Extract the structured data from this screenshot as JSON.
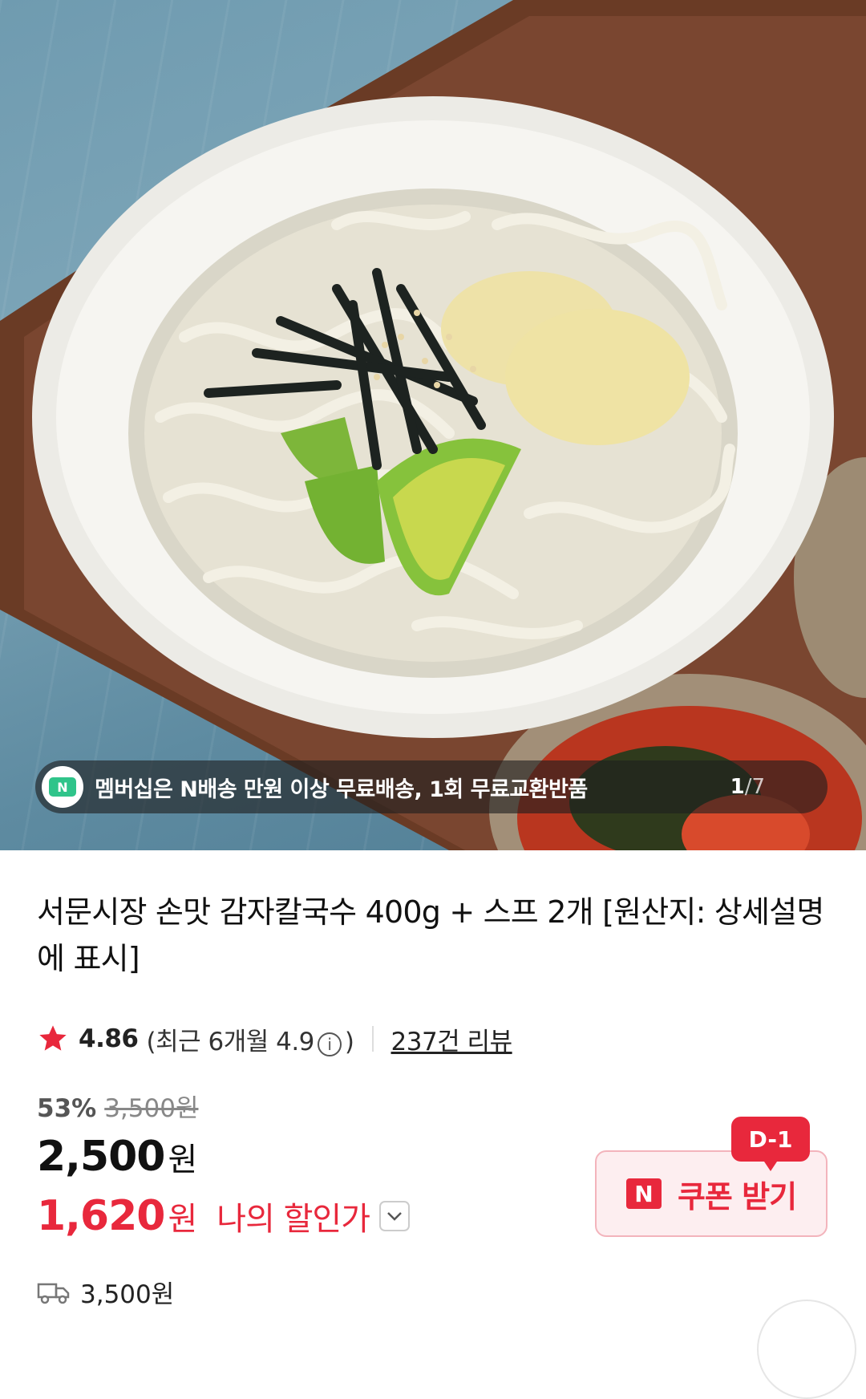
{
  "hero": {
    "banner_text": "멤버십은 N배송 만원 이상 무료배송, 1회 무료교환반품",
    "badge_letter": "N",
    "page_current": "1",
    "page_sep": "/",
    "page_total": "7"
  },
  "product": {
    "title": "서문시장 손맛 감자칼국수 400g + 스프 2개 [원산지: 상세설명에 표시]"
  },
  "rating": {
    "score": "4.86",
    "recent_prefix": "(최근 6개월 4.9",
    "info_glyph": "i",
    "recent_suffix": ")",
    "review_count": "237건 리뷰"
  },
  "price": {
    "discount_rate": "53%",
    "original": "3,500원",
    "sale_amount": "2,500",
    "sale_unit": "원",
    "my_amount": "1,620",
    "my_unit": "원",
    "my_label": "나의 할인가"
  },
  "coupon": {
    "badge_letter": "N",
    "label": "쿠폰 받기",
    "dday": "D-1"
  },
  "shipping": {
    "fee": "3,500원"
  },
  "colors": {
    "accent_red": "#e8283c",
    "membership_green": "#2fc48a",
    "coupon_bg": "#fdeef0"
  }
}
